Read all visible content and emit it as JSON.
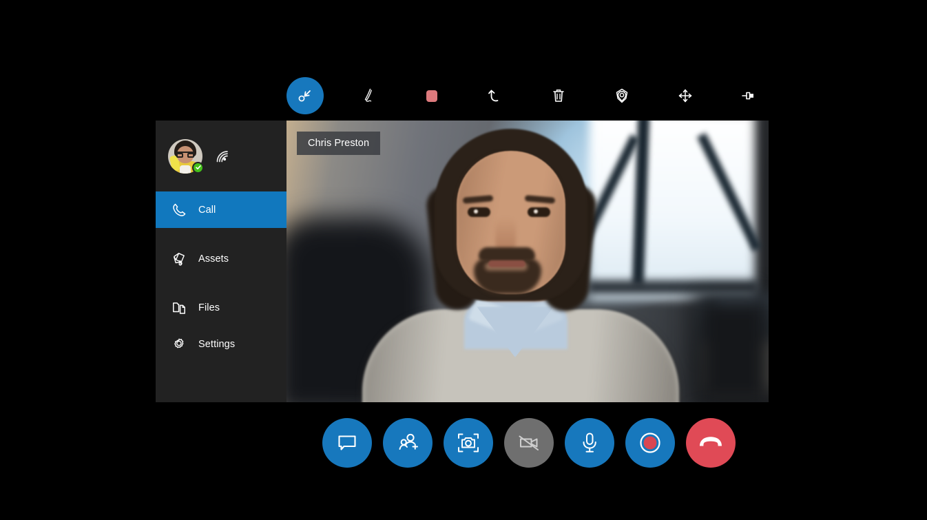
{
  "app": {
    "background_color": "#000000",
    "accent_blue": "#1778bd",
    "sidebar_bg": "#222222",
    "danger_red": "#e04a56",
    "status_green": "#45c11a"
  },
  "toolbar": {
    "name": "annotation-toolbar",
    "tools": [
      {
        "id": "pointer",
        "icon": "pointer-arrow-icon",
        "label": "Pointer",
        "active": true
      },
      {
        "id": "pen",
        "icon": "pen-icon",
        "label": "Pen",
        "active": false
      },
      {
        "id": "color",
        "icon": "color-swatch-icon",
        "label": "Color",
        "active": false,
        "color": "#dd7a7d"
      },
      {
        "id": "undo",
        "icon": "undo-icon",
        "label": "Undo",
        "active": false
      },
      {
        "id": "delete",
        "icon": "trash-icon",
        "label": "Delete",
        "active": false
      },
      {
        "id": "marker",
        "icon": "location-marker-icon",
        "label": "Marker",
        "active": false
      },
      {
        "id": "move",
        "icon": "move-arrows-icon",
        "label": "Move",
        "active": false
      },
      {
        "id": "pin",
        "icon": "pin-icon",
        "label": "Pin",
        "active": false
      }
    ]
  },
  "sidebar": {
    "user": {
      "avatar_name": "user-avatar",
      "presence": "available",
      "presence_icon": "check-badge-icon",
      "signal_icon": "wifi-signal-icon"
    },
    "items": [
      {
        "id": "call",
        "label": "Call",
        "icon": "phone-icon",
        "active": true
      },
      {
        "id": "assets",
        "label": "Assets",
        "icon": "box-package-icon",
        "active": false
      },
      {
        "id": "files",
        "label": "Files",
        "icon": "folder-files-icon",
        "active": false
      },
      {
        "id": "settings",
        "label": "Settings",
        "icon": "gear-icon",
        "active": false
      }
    ]
  },
  "video": {
    "participant_name": "Chris Preston",
    "name_tag": "participant-name-tag"
  },
  "controls": {
    "buttons": [
      {
        "id": "chat",
        "icon": "chat-bubble-icon",
        "label": "Chat",
        "style": "blue"
      },
      {
        "id": "add-participant",
        "icon": "add-person-icon",
        "label": "Add participant",
        "style": "blue"
      },
      {
        "id": "capture",
        "icon": "camera-capture-icon",
        "label": "Capture photo",
        "style": "blue"
      },
      {
        "id": "video-toggle",
        "icon": "camera-off-icon",
        "label": "Video off",
        "style": "gray"
      },
      {
        "id": "mic-toggle",
        "icon": "microphone-icon",
        "label": "Microphone",
        "style": "blue"
      },
      {
        "id": "record",
        "icon": "record-icon",
        "label": "Record",
        "style": "blue"
      },
      {
        "id": "end-call",
        "icon": "end-call-icon",
        "label": "End call",
        "style": "red"
      }
    ]
  }
}
